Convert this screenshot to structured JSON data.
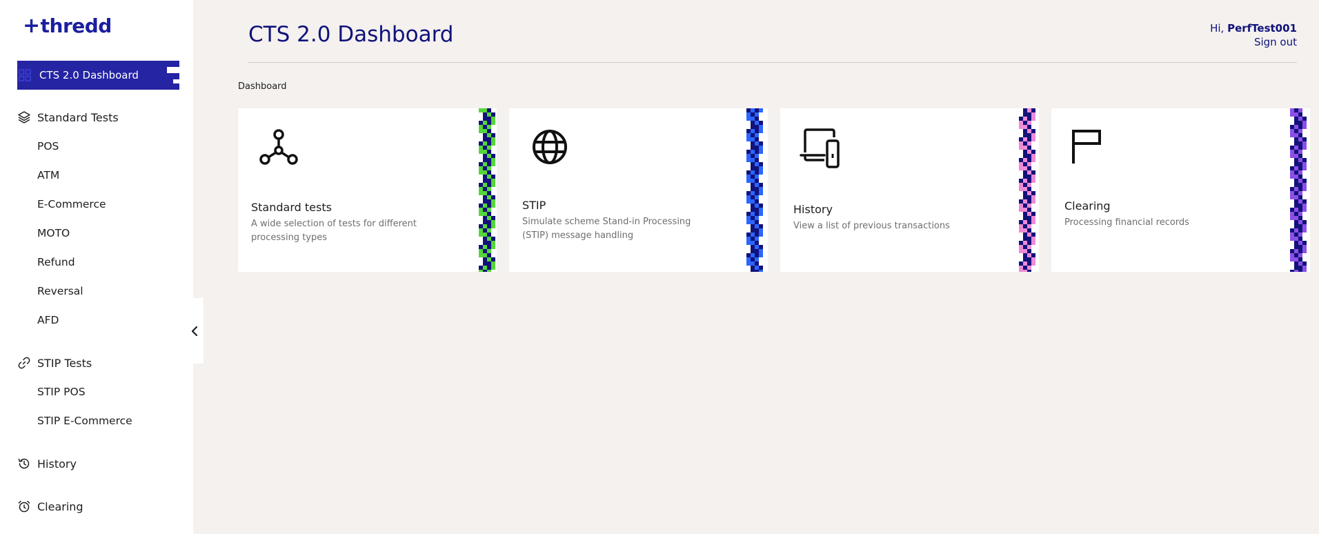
{
  "brand": {
    "logo_text": "thredd",
    "accent": "#2524a3"
  },
  "sidebar": {
    "active_item": "CTS 2.0 Dashboard",
    "sections": [
      {
        "label": "Standard Tests",
        "icon": "layers-icon"
      },
      {
        "label": "STIP Tests",
        "icon": "link-icon"
      },
      {
        "label": "History",
        "icon": "history-icon"
      },
      {
        "label": "Clearing",
        "icon": "alarm-clock-icon"
      }
    ],
    "standard_items": [
      "POS",
      "ATM",
      "E-Commerce",
      "MOTO",
      "Refund",
      "Reversal",
      "AFD"
    ],
    "stip_items": [
      "STIP POS",
      "STIP E-Commerce"
    ]
  },
  "header": {
    "title": "CTS 2.0 Dashboard",
    "greeting": "Hi,",
    "username": "PerfTest001",
    "signout": "Sign out"
  },
  "breadcrumb": "Dashboard",
  "cards": [
    {
      "title": "Standard tests",
      "desc": "A wide selection of tests for different processing types",
      "icon": "nodes-icon",
      "stripe_color": "#55d63b"
    },
    {
      "title": "STIP",
      "desc": "Simulate scheme Stand-in Processing (STIP) message handling",
      "icon": "globe-icon",
      "stripe_color": "#2a66ff"
    },
    {
      "title": "History",
      "desc": "View a list of previous transactions",
      "icon": "devices-icon",
      "stripe_color": "#ee8bd6"
    },
    {
      "title": "Clearing",
      "desc": "Processing financial records",
      "icon": "flag-icon",
      "stripe_color": "#8b4fe8"
    }
  ]
}
